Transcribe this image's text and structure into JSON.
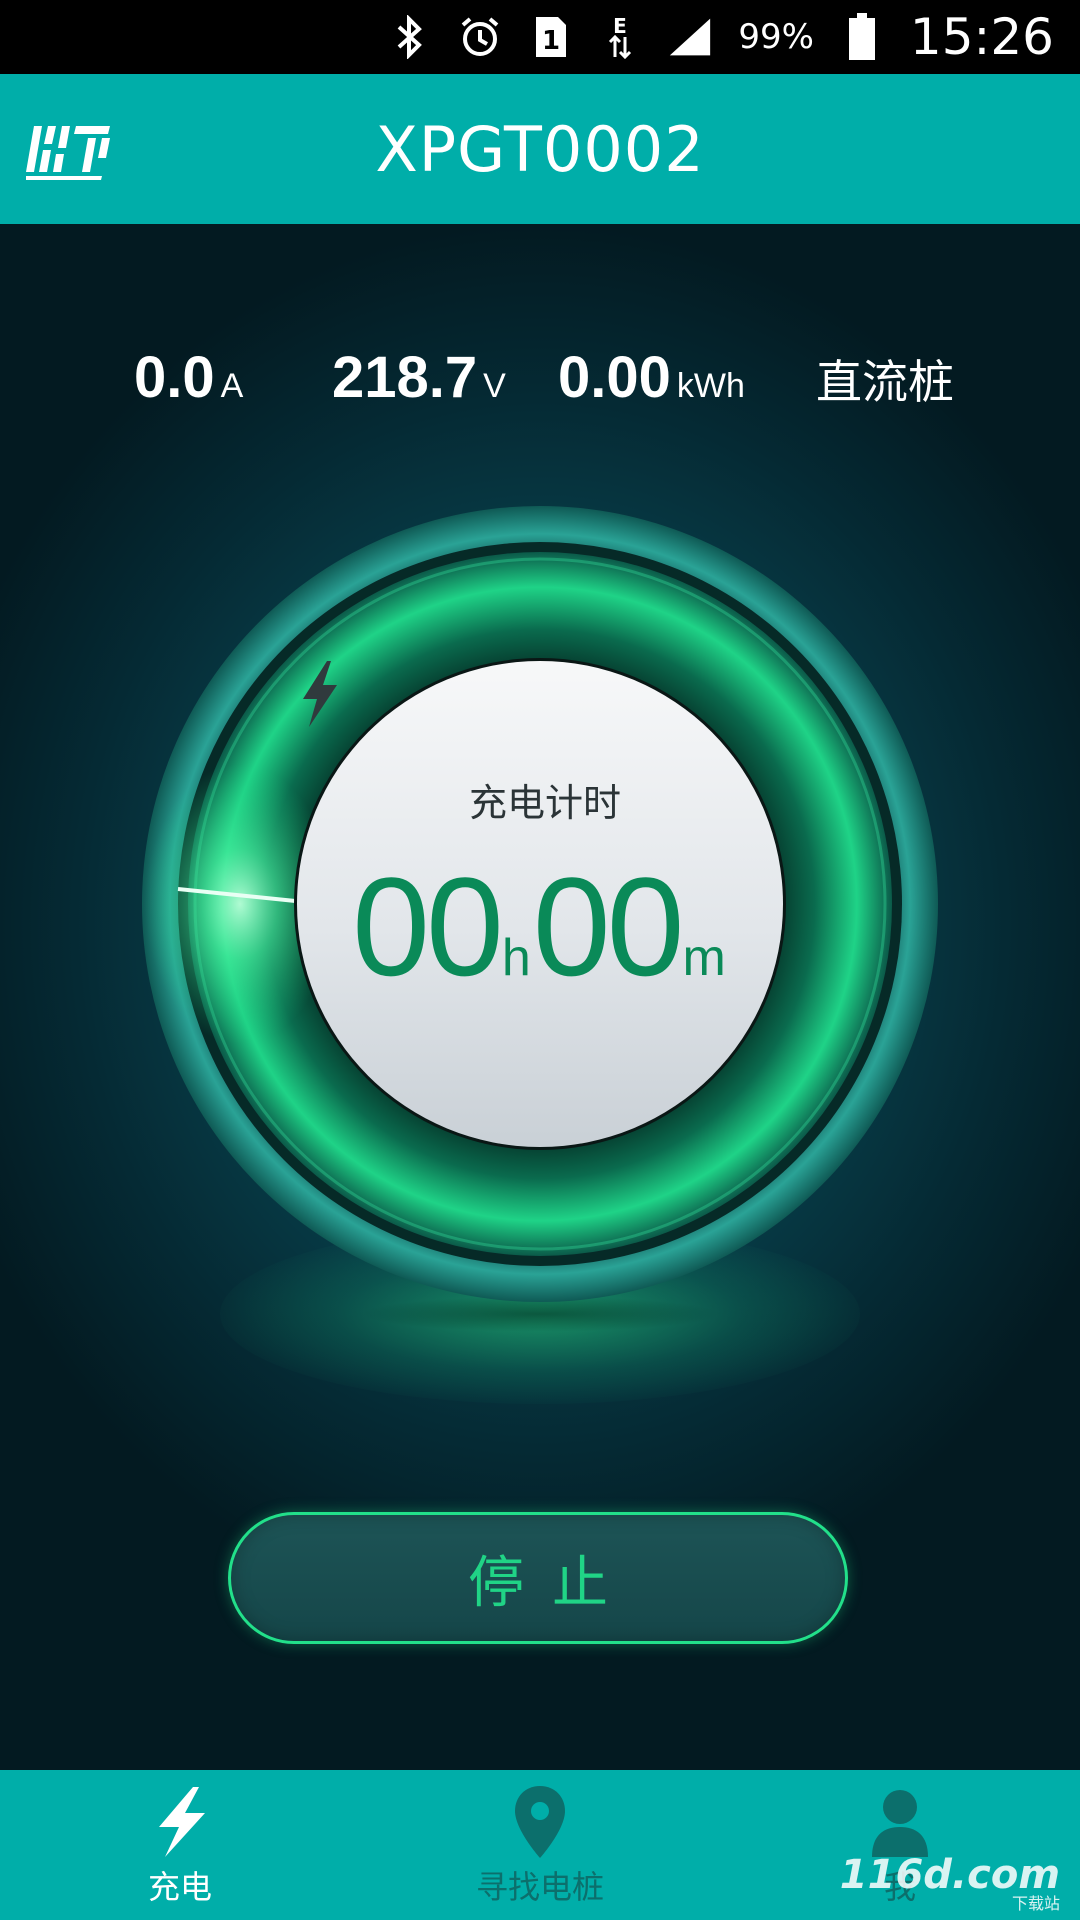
{
  "status_bar": {
    "icons": [
      "bluetooth-icon",
      "alarm-icon",
      "sim-1-icon",
      "data-e-icon",
      "signal-icon",
      "battery-icon"
    ],
    "battery": "99%",
    "time": "15:26"
  },
  "header": {
    "title": "XPGT0002",
    "logo_icon": "app-logo-icon"
  },
  "readouts": {
    "current": {
      "value": "0.0",
      "unit": "A"
    },
    "voltage": {
      "value": "218.7",
      "unit": "V"
    },
    "energy": {
      "value": "0.00",
      "unit": "kWh"
    },
    "pile_type": "直流桩"
  },
  "dial": {
    "label": "充电计时",
    "hours": "00",
    "hours_unit": "h",
    "minutes": "00",
    "minutes_unit": "m"
  },
  "actions": {
    "stop_label": "停止"
  },
  "bottom_nav": {
    "items": [
      {
        "label": "充电",
        "icon": "lightning-icon",
        "active": true
      },
      {
        "label": "寻找电桩",
        "icon": "map-pin-icon",
        "active": false
      },
      {
        "label": "我",
        "icon": "person-icon",
        "active": false
      }
    ]
  },
  "watermark": {
    "text": "116d.com",
    "sub": "下载站"
  },
  "colors": {
    "accent": "#00aea9",
    "green": "#0a8a58",
    "button_text": "#20d486"
  }
}
